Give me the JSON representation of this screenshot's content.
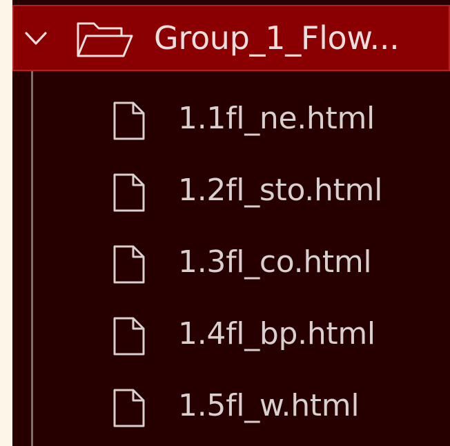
{
  "folder": {
    "label": "Group_1_Flow...",
    "expanded": true,
    "icon": "folder-open-icon",
    "chevron_icon": "chevron-down-icon"
  },
  "files": [
    {
      "name": "1.1fl_ne.html",
      "icon": "file-icon"
    },
    {
      "name": "1.2fl_sto.html",
      "icon": "file-icon"
    },
    {
      "name": "1.3fl_co.html",
      "icon": "file-icon"
    },
    {
      "name": "1.4fl_bp.html",
      "icon": "file-icon"
    },
    {
      "name": "1.5fl_w.html",
      "icon": "file-icon"
    }
  ],
  "colors": {
    "panel_background": "#260000",
    "selected_row": "#8a0000",
    "selected_border": "#b52020",
    "text": "#d9cfcf",
    "page_background": "#fdf6e8"
  }
}
